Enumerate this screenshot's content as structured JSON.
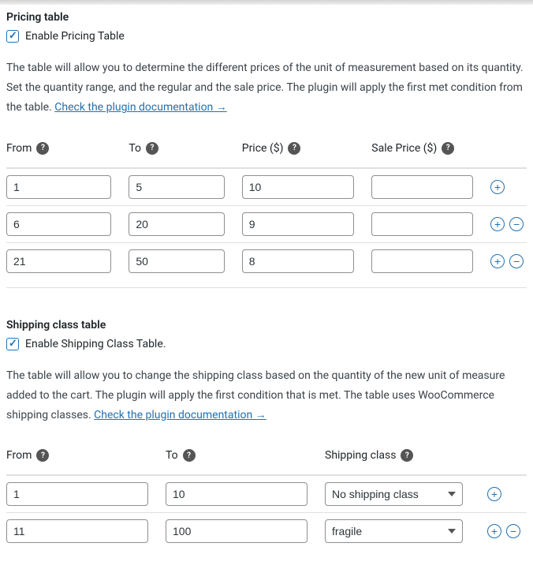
{
  "pricing": {
    "title": "Pricing table",
    "enable_label": "Enable Pricing Table",
    "enable_checked": true,
    "description_text": "The table will allow you to determine the different prices of the unit of measurement based on its quantity. Set the quantity range, and the regular and the sale price. The plugin will apply the first met condition from the table. ",
    "doc_link_text": "Check the plugin documentation →",
    "headers": {
      "from": "From",
      "to": "To",
      "price": "Price ($)",
      "sale": "Sale Price ($)"
    },
    "rows": [
      {
        "from": "1",
        "to": "5",
        "price": "10",
        "sale": ""
      },
      {
        "from": "6",
        "to": "20",
        "price": "9",
        "sale": ""
      },
      {
        "from": "21",
        "to": "50",
        "price": "8",
        "sale": ""
      }
    ]
  },
  "shipping": {
    "title": "Shipping class table",
    "enable_label": "Enable Shipping Class Table.",
    "enable_checked": true,
    "description_text": "The table will allow you to change the shipping class based on the quantity of the new unit of measure added to the cart. The plugin will apply the first condition that is met. The table uses WooCommerce shipping classes. ",
    "doc_link_text": "Check the plugin documentation →",
    "headers": {
      "from": "From",
      "to": "To",
      "class": "Shipping class"
    },
    "rows": [
      {
        "from": "1",
        "to": "10",
        "class": "No shipping class"
      },
      {
        "from": "11",
        "to": "100",
        "class": "fragile"
      }
    ]
  },
  "icons": {
    "help": "?",
    "add": "+",
    "remove": "−"
  }
}
